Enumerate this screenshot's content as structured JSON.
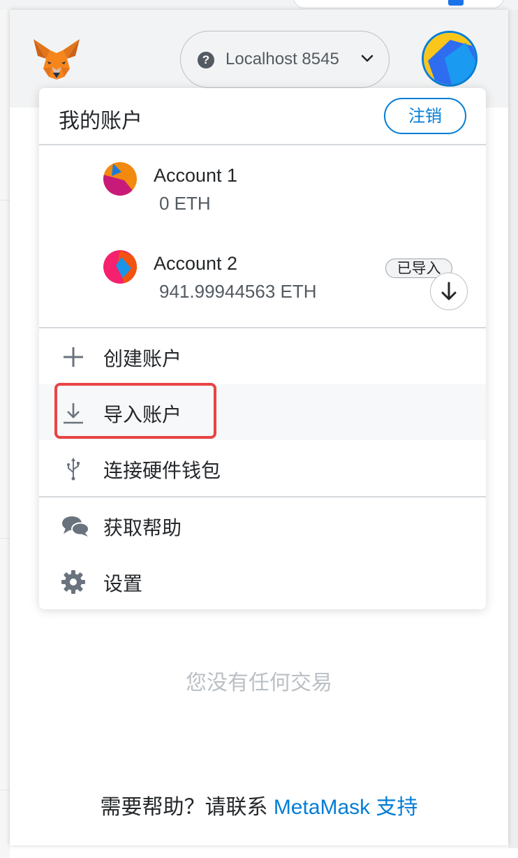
{
  "header": {
    "network_label": "Localhost 8545",
    "network_status_icon": "question-icon"
  },
  "menu": {
    "title": "我的账户",
    "logout_label": "注销",
    "accounts": [
      {
        "name": "Account 1",
        "balance": "0 ETH"
      },
      {
        "name": "Account 2",
        "balance": "941.99944563 ETH",
        "badge": "已导入"
      }
    ],
    "items": {
      "create": "创建账户",
      "import": "导入账户",
      "hardware": "连接硬件钱包",
      "support": "获取帮助",
      "settings": "设置"
    }
  },
  "main": {
    "no_transactions": "您没有任何交易",
    "help_prefix": "需要帮助？请联系 ",
    "help_link": "MetaMask 支持"
  },
  "colors": {
    "accent": "#037dd6",
    "highlight": "#e94444"
  }
}
